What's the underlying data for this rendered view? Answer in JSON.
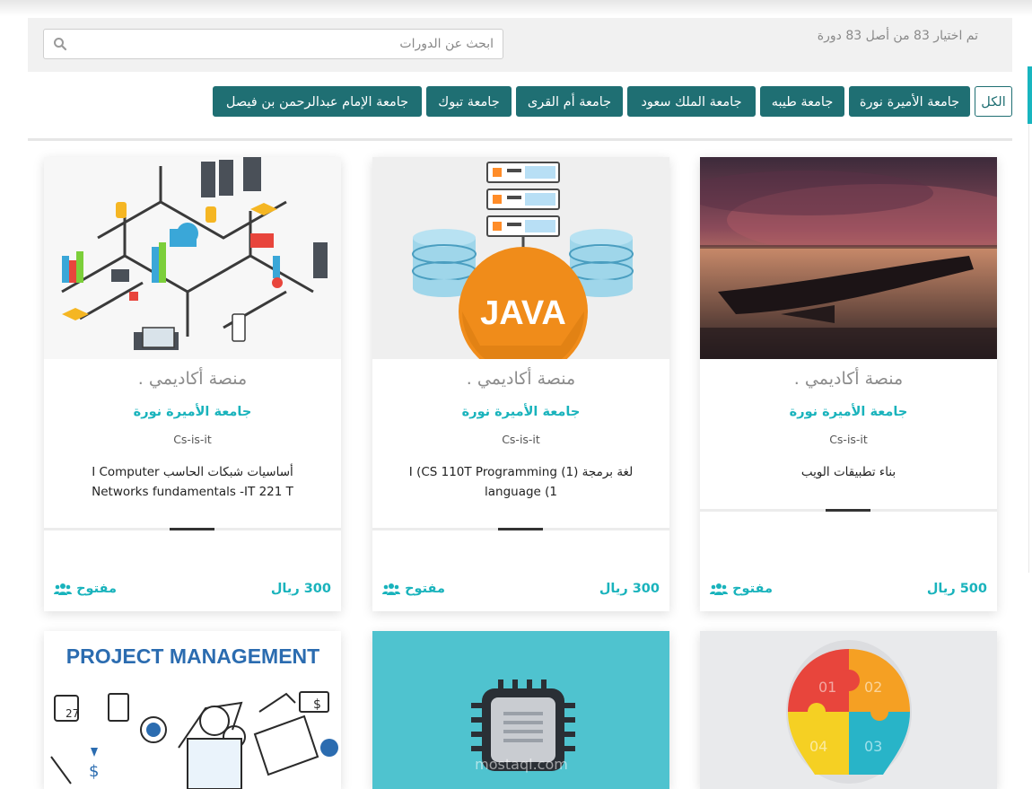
{
  "search": {
    "placeholder": "ابحث عن الدورات"
  },
  "summary": {
    "count_text": "تم اختيار 83 من أصل 83 دورة"
  },
  "filters": [
    "الكل",
    "جامعة الأميرة نورة",
    "جامعة طيبه",
    "جامعة الملك سعود",
    "جامعة أم القرى",
    "جامعة تبوك",
    "جامعة الإمام عبدالرحمن بن فيصل"
  ],
  "courses": [
    {
      "platform": "منصة أكاديمي .",
      "university": "جامعة الأميرة نورة",
      "category": "Cs-is-it",
      "title": "بناء تطبيقات الويب",
      "price": "500 ريال",
      "status": "مفتوح",
      "image": "sunset-boat"
    },
    {
      "platform": "منصة أكاديمي .",
      "university": "جامعة الأميرة نورة",
      "category": "Cs-is-it",
      "title": "لغة برمجة (1) I (CS 110T Programming language (1",
      "price": "300 ريال",
      "status": "مفتوح",
      "image": "java-servers"
    },
    {
      "platform": "منصة أكاديمي .",
      "university": "جامعة الأميرة نورة",
      "category": "Cs-is-it",
      "title": "أساسيات شبكات الحاسب I Computer Networks fundamentals -IT 221 T",
      "price": "300 ريال",
      "status": "مفتوح",
      "image": "isometric-network"
    },
    {
      "image": "puzzle-bulb"
    },
    {
      "image": "microchip",
      "watermark": "mostaql.com"
    },
    {
      "image": "project-management",
      "image_text": "PROJECT MANAGEMENT"
    }
  ],
  "colors": {
    "accent": "#19b3bc",
    "chip": "#1f6f73",
    "text": "#222222"
  },
  "icons": {
    "search": "search-icon",
    "users": "users-icon"
  }
}
